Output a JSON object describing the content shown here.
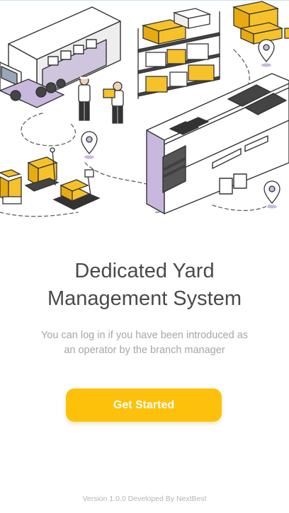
{
  "onboarding": {
    "title_line1": "Dedicated Yard",
    "title_line2": "Management System",
    "description": "You can log in if you have been introduced as an operator by the branch manager",
    "cta_label": "Get Started",
    "footer": "Version 1.0.0 Developed By NextBest"
  },
  "colors": {
    "accent": "#fec10b",
    "title": "#4a4a4a",
    "muted": "#a6a6a6",
    "illustration_purple": "#c9b8dd",
    "illustration_yellow": "#f6c22b"
  },
  "icons": [
    "truck-icon",
    "warehouse-icon",
    "shelf-icon",
    "location-pin-icon",
    "box-icon",
    "scale-icon"
  ]
}
